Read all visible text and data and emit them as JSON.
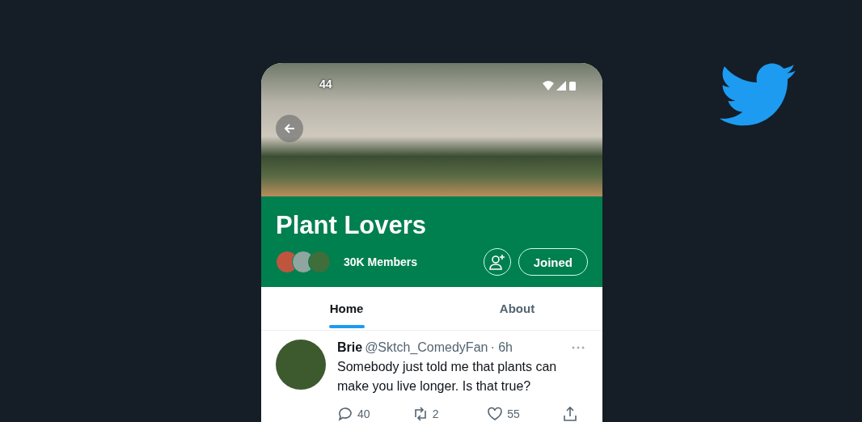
{
  "status_bar": {
    "time": "44"
  },
  "community": {
    "name": "Plant Lovers",
    "members": "30K Members",
    "join_button": "Joined"
  },
  "tabs": [
    {
      "label": "Home",
      "selected": true
    },
    {
      "label": "About",
      "selected": false
    }
  ],
  "tweet": {
    "name": "Brie",
    "handle": "@Sktch_ComedyFan",
    "time": "· 6h",
    "text": "Somebody just told me that plants can make you live longer. Is that true?",
    "actions": [
      {
        "kind": "reply",
        "count": "40"
      },
      {
        "kind": "retweet",
        "count": "2"
      },
      {
        "kind": "like",
        "count": "55"
      },
      {
        "kind": "share"
      }
    ]
  }
}
